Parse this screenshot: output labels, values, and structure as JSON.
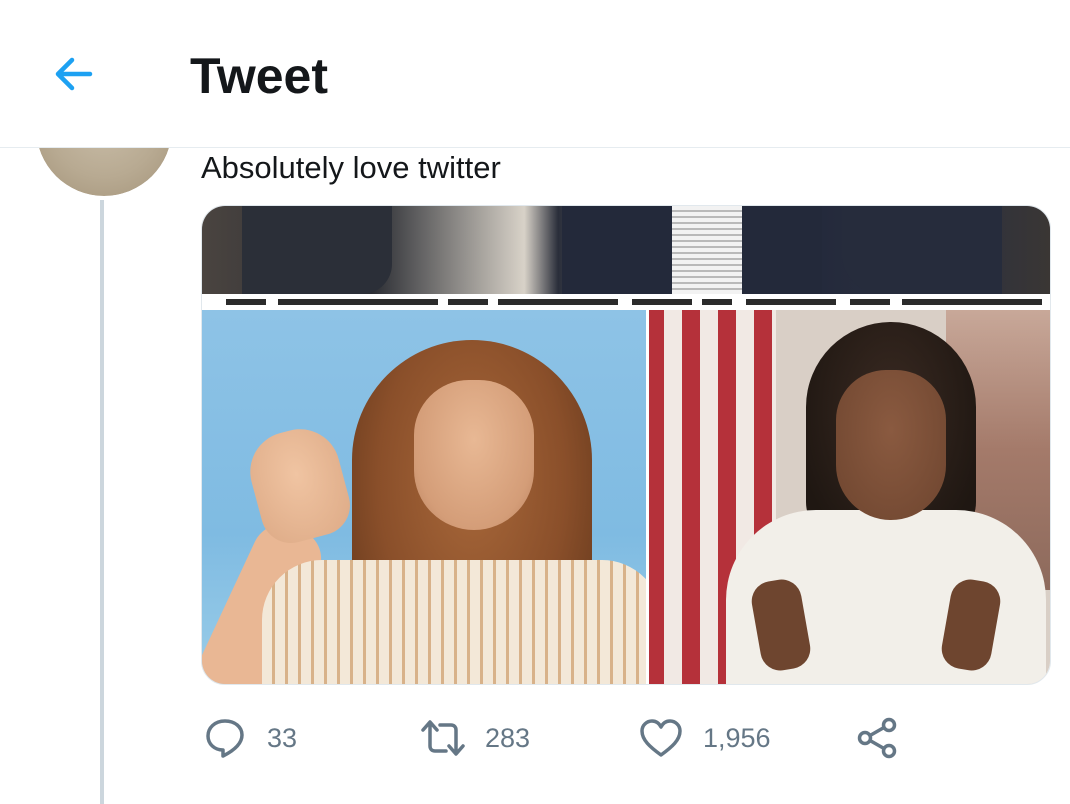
{
  "header": {
    "title": "Tweet",
    "back_icon": "arrow-left-icon"
  },
  "tweet": {
    "text": "Absolutely love twitter",
    "avatar_icon": "avatar"
  },
  "actions": {
    "reply_count": "33",
    "retweet_count": "283",
    "like_count": "1,956"
  },
  "colors": {
    "accent": "#1da1f2",
    "icon_gray": "#657786",
    "thread_line": "#ccd6dd"
  }
}
